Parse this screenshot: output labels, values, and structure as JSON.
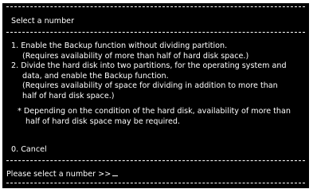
{
  "title": "Select a number",
  "options": [
    {
      "line1": "1. Enable the Backup function without dividing partition.",
      "lines": [
        "(Requires availability of more than half of hard disk space.)"
      ]
    },
    {
      "line1": "2. Divide the hard disk into two partitions, for the operating system and",
      "lines": [
        "data, and enable the Backup function.",
        "(Requires availability of space for dividing in addition to more than",
        "half of hard disk space.)"
      ]
    }
  ],
  "note": {
    "line1": "* Depending on the condition of the hard disk, availability of more than",
    "line2": "half of hard disk space may be required."
  },
  "cancel": "0. Cancel",
  "prompt": "Please select a number >>"
}
